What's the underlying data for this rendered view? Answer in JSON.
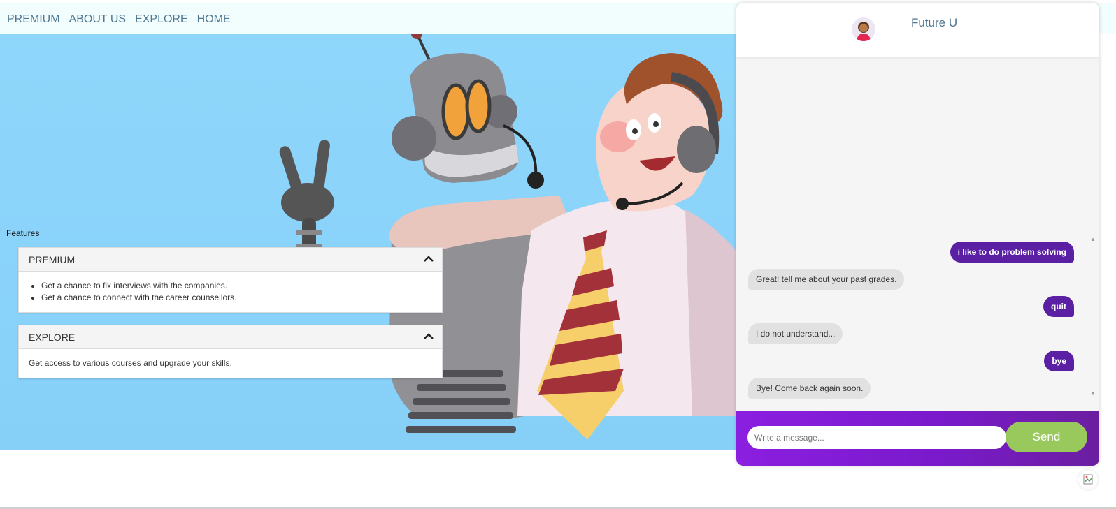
{
  "nav": {
    "items": [
      "PREMIUM",
      "ABOUT US",
      "EXPLORE",
      "HOME"
    ]
  },
  "features": {
    "title": "Features",
    "sections": [
      {
        "title": "PREMIUM",
        "items": [
          "Get a chance to fix interviews with the companies.",
          "Get a chance to connect with the career counsellors."
        ]
      },
      {
        "title": "EXPLORE",
        "text": "Get access to various courses and upgrade your skills."
      }
    ]
  },
  "chat": {
    "title": "Future U",
    "messages": [
      {
        "from": "user",
        "text": "i like to do problem solving"
      },
      {
        "from": "bot",
        "text": "Great! tell me about your past grades."
      },
      {
        "from": "user",
        "text": "quit"
      },
      {
        "from": "bot",
        "text": "I do not understand..."
      },
      {
        "from": "user",
        "text": "bye"
      },
      {
        "from": "bot",
        "text": "Bye! Come back again soon."
      }
    ],
    "input_placeholder": "Write a message...",
    "send_label": "Send"
  },
  "colors": {
    "nav_text": "#4e7791",
    "hero_sky": "#8fd6fb",
    "user_bubble": "#5a1fa3",
    "bot_bubble": "#e1e1e1",
    "composer": "#8b1fe0",
    "send_button": "#99c85c"
  },
  "icons": {
    "avatar": "woman-avatar-icon",
    "accordion_toggle": "chevron-up-icon",
    "broken_image": "broken-image-icon"
  }
}
